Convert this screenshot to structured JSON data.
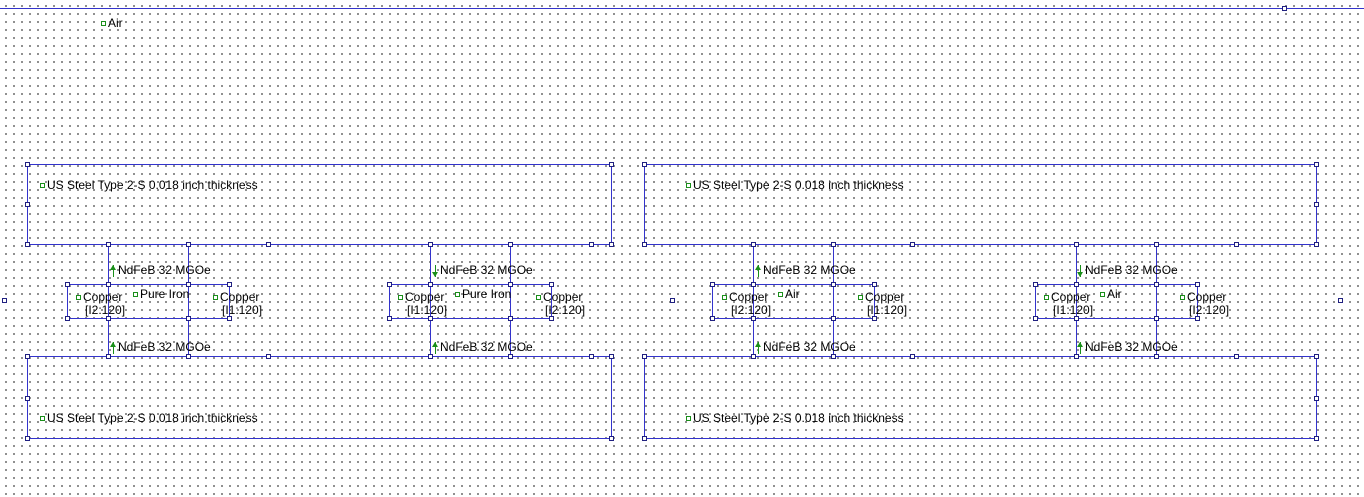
{
  "labels": {
    "air": "Air",
    "steel": "US Steel Type 2-S 0.018 inch thickness",
    "magnet": "NdFeB 32 MGOe",
    "copper": "Copper",
    "pure_iron": "Pure Iron",
    "circuit_i2": "[I2:120]",
    "circuit_i1": "[I1:120]"
  },
  "colors": {
    "boundary": "#3333cc",
    "node": "#202080",
    "block_marker": "#1a8f1a",
    "grid_dot": "#7f7f7f"
  }
}
